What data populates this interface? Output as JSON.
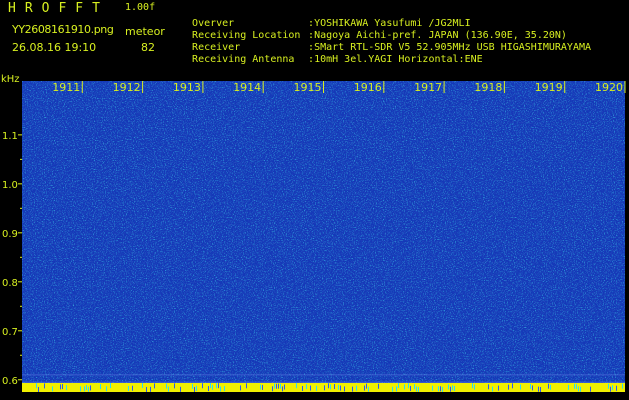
{
  "header": {
    "app_title": "HROFFT",
    "app_version": "1.00f",
    "file_name": "YY2608161910.png",
    "meteor_label": "meteor",
    "timestamp": "26.08.16 19:10",
    "meteor_count": "82"
  },
  "info": [
    {
      "key": "Overver",
      "value": ":YOSHIKAWA Yasufumi /JG2MLI"
    },
    {
      "key": "Receiving Location",
      "value": ":Nagoya Aichi-pref. JAPAN (136.90E, 35.20N)"
    },
    {
      "key": "Receiver",
      "value": ":SMart RTL-SDR V5 52.905MHz USB HIGASHIMURAYAMA"
    },
    {
      "key": "Receiving Antenna",
      "value": ":10mH 3el.YAGI Horizontal:ENE"
    }
  ],
  "spectrogram": {
    "unit_label": "kHz",
    "time_labels": [
      "1911",
      "1912",
      "1913",
      "1914",
      "1915",
      "1916",
      "1917",
      "1918",
      "1919",
      "1920"
    ],
    "freq_labels": [
      "1.1",
      "1.0",
      "0.9",
      "0.8",
      "0.7",
      "0.6"
    ],
    "freq_values": [
      1.1,
      1.0,
      0.9,
      0.8,
      0.7,
      0.6
    ],
    "freq_range": [
      0.575,
      1.21
    ],
    "colors": {
      "background": "#1438b8",
      "noise_dark": "#0a1c8a",
      "noise_light": "#30d8f0",
      "noise_green": "#40e040",
      "bottom_band": "#f0f000",
      "label": "#d8f020"
    }
  }
}
